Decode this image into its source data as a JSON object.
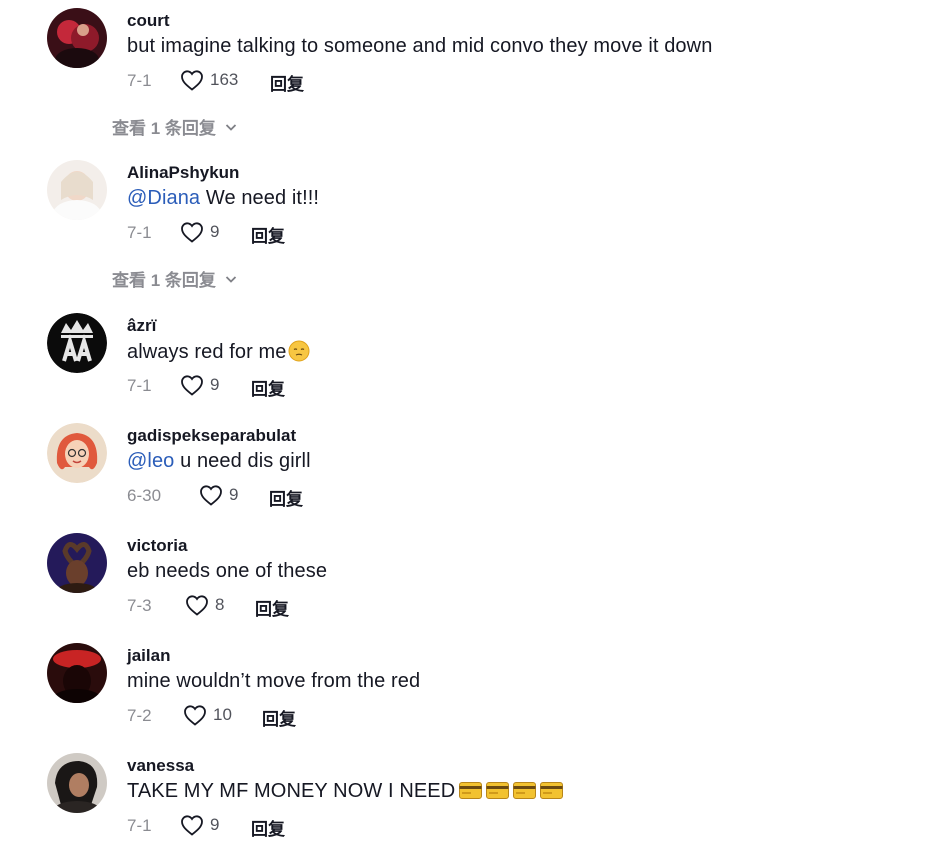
{
  "reply_label": "回复",
  "comments": [
    {
      "username": "court",
      "text": "but imagine talking to someone and mid convo they move it down",
      "date": "7-1",
      "likes": "163",
      "view_replies": "查看 1 条回复",
      "avatar_icon": "profile-photo"
    },
    {
      "username": "AlinaPshykun",
      "mention": "@Diana",
      "text": " We need it!!!",
      "date": "7-1",
      "likes": "9",
      "view_replies": "查看 1 条回复",
      "avatar_icon": "profile-photo"
    },
    {
      "username": "âzrï",
      "text": "always red for me",
      "emoji": "pleading-face",
      "date": "7-1",
      "likes": "9",
      "avatar_icon": "crown-logo"
    },
    {
      "username": "gadispekseparabulat",
      "mention": "@leo",
      "text": " u need dis girll",
      "date": "6-30",
      "likes": "9",
      "avatar_icon": "cartoon-girl"
    },
    {
      "username": "victoria",
      "text": "eb needs one of these",
      "date": "7-3",
      "likes": "8",
      "avatar_icon": "profile-photo"
    },
    {
      "username": "jailan",
      "text": "mine wouldn’t move from the red",
      "date": "7-2",
      "likes": "10",
      "avatar_icon": "profile-photo"
    },
    {
      "username": "vanessa",
      "text": "TAKE MY MF MONEY NOW I NEED",
      "emoji": "credit-card x4",
      "date": "7-1",
      "likes": "9",
      "avatar_icon": "profile-photo"
    }
  ],
  "colors": {
    "text": "#161823",
    "mention": "#2b5db9",
    "muted": "rgba(22,24,35,0.5)"
  }
}
